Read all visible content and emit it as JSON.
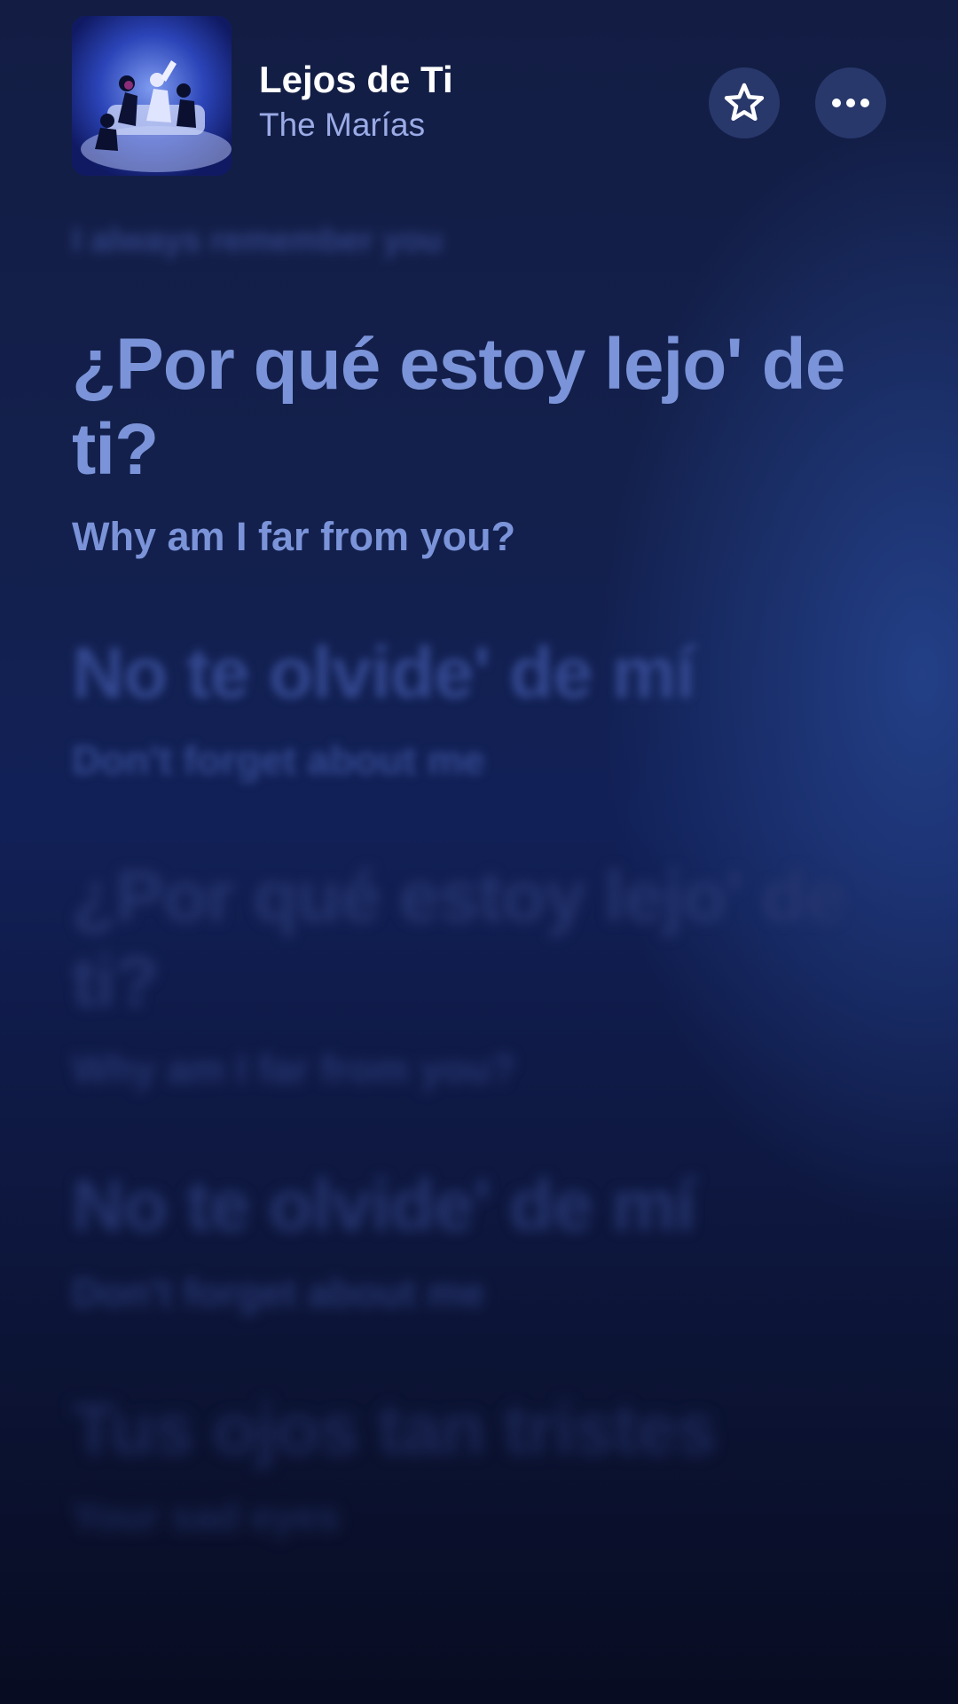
{
  "header": {
    "song_title": "Lejos de Ti",
    "artist": "The Marías",
    "artwork_icon": "album-artwork",
    "favorite_icon": "star-icon",
    "more_icon": "more-icon"
  },
  "lyrics": {
    "previous_line": "I always remember you",
    "lines": [
      {
        "original": "¿Por qué estoy lejo' de ti?",
        "translation": "Why am I far from you?",
        "state": "active"
      },
      {
        "original": "No te olvide' de mí",
        "translation": "Don't forget about me",
        "state": "upcoming"
      },
      {
        "original": "¿Por qué estoy lejo' de ti?",
        "translation": "Why am I far from you?",
        "state": "upcoming"
      },
      {
        "original": "No te olvide' de mí",
        "translation": "Don't forget about me",
        "state": "upcoming"
      },
      {
        "original": "Tus ojos tan tristes",
        "translation": "Your sad eyes",
        "state": "upcoming"
      }
    ]
  },
  "colors": {
    "active_lyric": "#7b93d8",
    "artist_text": "#9aabe6",
    "background_top": "#131d44",
    "background_bottom": "#080c22"
  }
}
